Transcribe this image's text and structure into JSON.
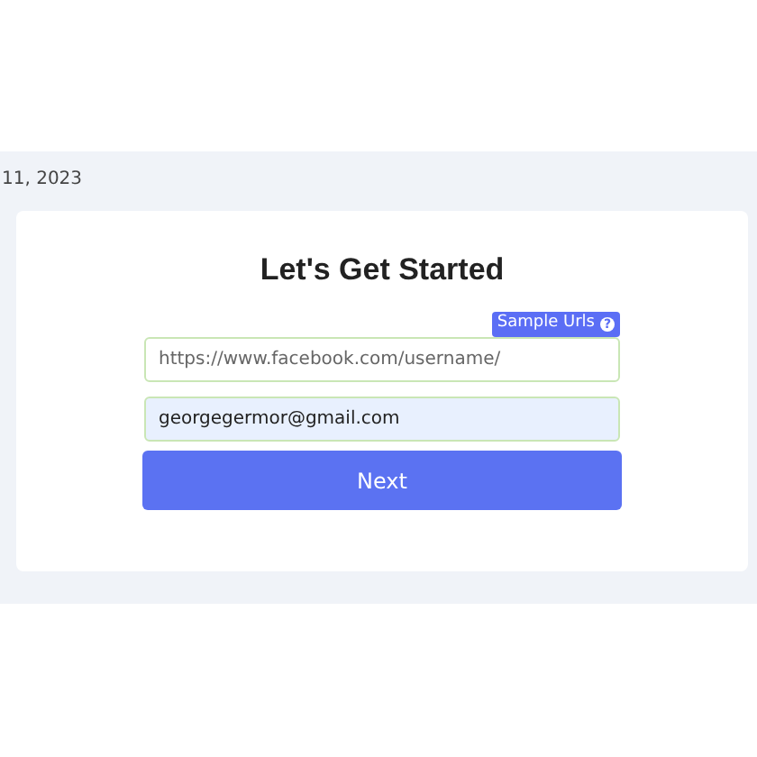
{
  "date": "11, 2023",
  "card": {
    "title": "Let's Get Started",
    "sample_urls": {
      "label": "Sample Urls",
      "icon": "?"
    },
    "url_field": {
      "placeholder": "https://www.facebook.com/username/"
    },
    "email_field": {
      "value": "georgegermor@gmail.com"
    },
    "button": "Next"
  }
}
